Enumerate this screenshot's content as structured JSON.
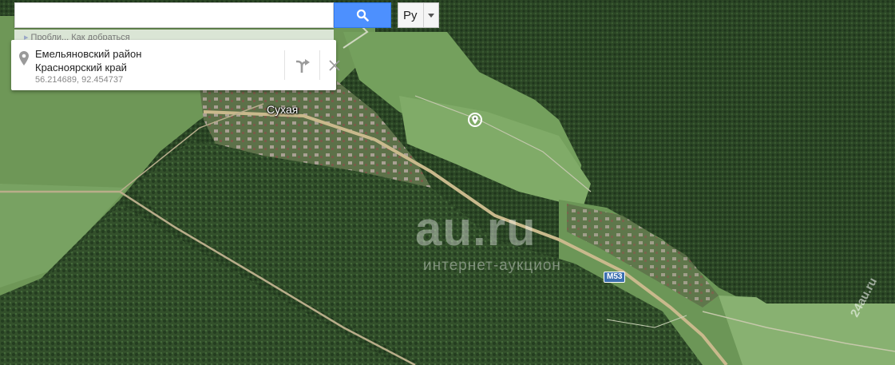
{
  "search": {
    "value": "",
    "placeholder": ""
  },
  "language": {
    "selected": "Ру"
  },
  "directions_hint": "Пробли... Как добраться",
  "info_card": {
    "line1": "Емельяновский район",
    "line2": "Красноярский край",
    "coordinates": "56.214689, 92.454737"
  },
  "map": {
    "place_label": "Сухая",
    "road_shield": "M53"
  },
  "watermark": {
    "main": "au.ru",
    "sub": "интернет-аукцион",
    "corner": "24au.ru"
  },
  "colors": {
    "search_button": "#4d90fe",
    "road_shield": "#3c6fb0",
    "forest": "#2e4a27",
    "field": "#6f9a58"
  },
  "icons": {
    "search": "magnifier-icon",
    "pin": "map-pin-icon",
    "directions": "directions-arrow-icon",
    "close": "close-icon",
    "marker": "location-marker-icon"
  }
}
